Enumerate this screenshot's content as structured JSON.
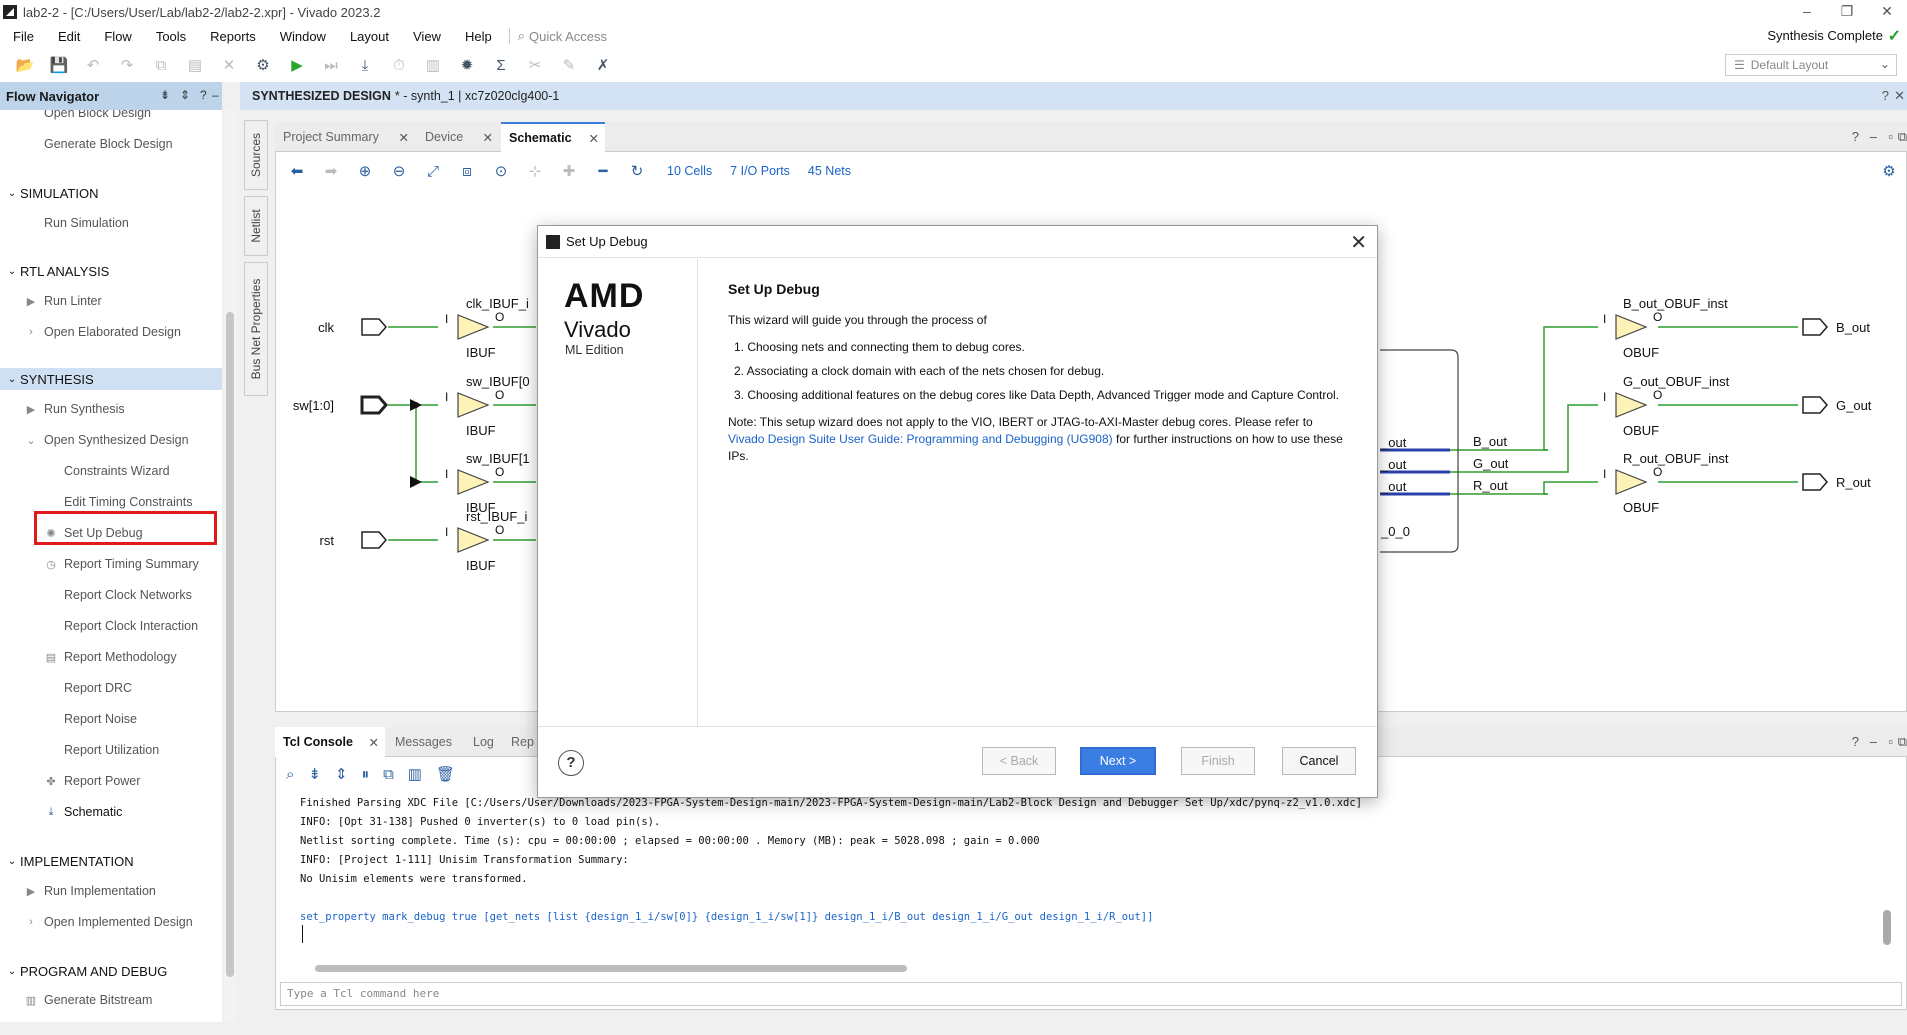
{
  "window": {
    "title": "lab2-2 - [C:/Users/User/Lab/lab2-2/lab2-2.xpr] - Vivado 2023.2",
    "status": "Synthesis Complete"
  },
  "menu": {
    "items": [
      "File",
      "Edit",
      "Flow",
      "Tools",
      "Reports",
      "Window",
      "Layout",
      "View",
      "Help"
    ],
    "quick_access": "Quick Access"
  },
  "layout_select": "Default Layout",
  "flow_nav": {
    "title": "Flow Navigator",
    "items": {
      "open_block": "Open Block Design",
      "generate_block": "Generate Block Design",
      "simulation": "SIMULATION",
      "run_simulation": "Run Simulation",
      "rtl_analysis": "RTL ANALYSIS",
      "run_linter": "Run Linter",
      "open_elaborated": "Open Elaborated Design",
      "synthesis": "SYNTHESIS",
      "run_synthesis": "Run Synthesis",
      "open_synthesized": "Open Synthesized Design",
      "constraints_wizard": "Constraints Wizard",
      "edit_timing": "Edit Timing Constraints",
      "setup_debug": "Set Up Debug",
      "report_timing": "Report Timing Summary",
      "report_clock_networks": "Report Clock Networks",
      "report_clock_interaction": "Report Clock Interaction",
      "report_methodology": "Report Methodology",
      "report_drc": "Report DRC",
      "report_noise": "Report Noise",
      "report_utilization": "Report Utilization",
      "report_power": "Report Power",
      "schematic": "Schematic",
      "implementation": "IMPLEMENTATION",
      "run_implementation": "Run Implementation",
      "open_implemented": "Open Implemented Design",
      "program_debug": "PROGRAM AND DEBUG",
      "generate_bitstream": "Generate Bitstream"
    }
  },
  "design_header": {
    "title": "SYNTHESIZED DESIGN",
    "suffix": "* - synth_1 | xc7z020clg400-1"
  },
  "side_tabs": [
    "Sources",
    "Netlist",
    "Bus Net Properties"
  ],
  "doc_tabs": [
    "Project Summary",
    "Device",
    "Schematic"
  ],
  "schematic_stats": {
    "cells": "10 Cells",
    "io_ports": "7 I/O Ports",
    "nets": "45 Nets"
  },
  "schematic": {
    "inputs": [
      {
        "port": "clk",
        "inst": "clk_IBUF_i",
        "type": "IBUF"
      },
      {
        "port": "sw[1:0]",
        "inst": "sw_IBUF[0",
        "type": "IBUF"
      },
      {
        "port": "",
        "inst": "sw_IBUF[1",
        "type": "IBUF"
      },
      {
        "port": "rst",
        "inst": "rst_IBUF_i",
        "type": "IBUF"
      }
    ],
    "outputs": [
      {
        "port": "B_out",
        "inst": "B_out_OBUF_inst",
        "type": "OBUF"
      },
      {
        "port": "G_out",
        "inst": "G_out_OBUF_inst",
        "type": "OBUF"
      },
      {
        "port": "R_out",
        "inst": "R_out_OBUF_inst",
        "type": "OBUF"
      }
    ],
    "pin_i": "I",
    "pin_o": "O",
    "block_pins": [
      "_out",
      "_out",
      "_out"
    ],
    "block_nets": [
      "B_out",
      "G_out",
      "R_out"
    ],
    "block_label": "_0_0"
  },
  "console_tabs": [
    "Tcl Console",
    "Messages",
    "Log",
    "Rep"
  ],
  "console": {
    "lines": [
      "Finished Parsing XDC File [C:/Users/User/Downloads/2023-FPGA-System-Design-main/2023-FPGA-System-Design-main/Lab2-Block Design and Debugger Set Up/xdc/pynq-z2_v1.0.xdc]",
      "INFO: [Opt 31-138] Pushed 0 inverter(s) to 0 load pin(s).",
      "Netlist sorting complete. Time (s): cpu = 00:00:00 ; elapsed = 00:00:00 . Memory (MB): peak = 5028.098 ; gain = 0.000",
      "INFO: [Project 1-111] Unisim Transformation Summary:",
      "No Unisim elements were transformed."
    ],
    "command": "set_property mark_debug true [get_nets [list {design_1_i/sw[0]} {design_1_i/sw[1]} design_1_i/B_out design_1_i/G_out design_1_i/R_out]]",
    "input_placeholder": "Type a Tcl command here"
  },
  "dialog": {
    "title": "Set Up Debug",
    "logo_amd": "AMD",
    "logo_vivado": "Vivado",
    "logo_edition": "ML Edition",
    "heading": "Set Up Debug",
    "intro": "This wizard will guide you through the process of",
    "steps": [
      "1.  Choosing nets and connecting them to debug cores.",
      "2.  Associating a clock domain with each of the nets chosen for debug.",
      "3.  Choosing additional features on the debug cores like Data Depth, Advanced Trigger mode and Capture Control."
    ],
    "note_prefix": "Note: This setup wizard does not apply to the VIO, IBERT or JTAG-to-AXI-Master debug cores. Please refer to",
    "note_link": "Vivado Design Suite User Guide: Programming and Debugging (UG908)",
    "note_suffix": " for further instructions on how to use these IPs.",
    "buttons": {
      "back": "< Back",
      "next": "Next >",
      "finish": "Finish",
      "cancel": "Cancel"
    }
  }
}
